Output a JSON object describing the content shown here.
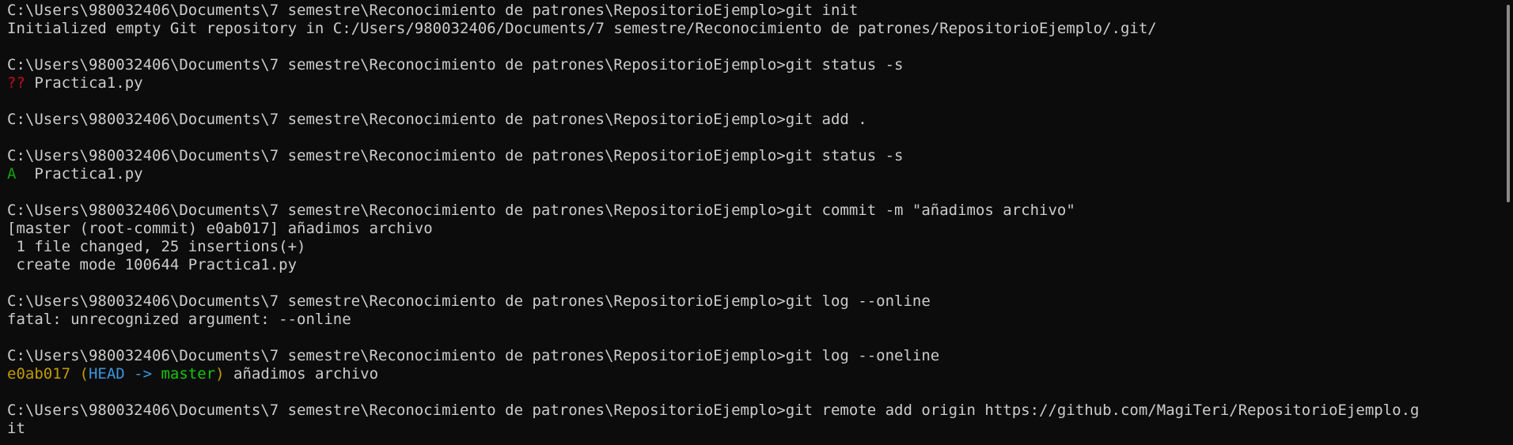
{
  "terminal": {
    "lines": [
      [
        {
          "text": "C:\\Users\\980032406\\Documents\\7 semestre\\Reconocimiento de patrones\\RepositorioEjemplo>git init",
          "color": "default"
        }
      ],
      [
        {
          "text": "Initialized empty Git repository in C:/Users/980032406/Documents/7 semestre/Reconocimiento de patrones/RepositorioEjemplo/.git/",
          "color": "default"
        }
      ],
      [],
      [
        {
          "text": "C:\\Users\\980032406\\Documents\\7 semestre\\Reconocimiento de patrones\\RepositorioEjemplo>git status -s",
          "color": "default"
        }
      ],
      [
        {
          "text": "??",
          "color": "red"
        },
        {
          "text": " Practica1.py",
          "color": "default"
        }
      ],
      [],
      [
        {
          "text": "C:\\Users\\980032406\\Documents\\7 semestre\\Reconocimiento de patrones\\RepositorioEjemplo>git add .",
          "color": "default"
        }
      ],
      [],
      [
        {
          "text": "C:\\Users\\980032406\\Documents\\7 semestre\\Reconocimiento de patrones\\RepositorioEjemplo>git status -s",
          "color": "default"
        }
      ],
      [
        {
          "text": "A",
          "color": "green"
        },
        {
          "text": "  Practica1.py",
          "color": "default"
        }
      ],
      [],
      [
        {
          "text": "C:\\Users\\980032406\\Documents\\7 semestre\\Reconocimiento de patrones\\RepositorioEjemplo>git commit -m \"añadimos archivo\"",
          "color": "default"
        }
      ],
      [
        {
          "text": "[master (root-commit) e0ab017] añadimos archivo",
          "color": "default"
        }
      ],
      [
        {
          "text": " 1 file changed, 25 insertions(+)",
          "color": "default"
        }
      ],
      [
        {
          "text": " create mode 100644 Practica1.py",
          "color": "default"
        }
      ],
      [],
      [
        {
          "text": "C:\\Users\\980032406\\Documents\\7 semestre\\Reconocimiento de patrones\\RepositorioEjemplo>git log --online",
          "color": "default"
        }
      ],
      [
        {
          "text": "fatal: unrecognized argument: --online",
          "color": "default"
        }
      ],
      [],
      [
        {
          "text": "C:\\Users\\980032406\\Documents\\7 semestre\\Reconocimiento de patrones\\RepositorioEjemplo>git log --oneline",
          "color": "default"
        }
      ],
      [
        {
          "text": "e0ab017",
          "color": "yellow"
        },
        {
          "text": " (",
          "color": "yellow"
        },
        {
          "text": "HEAD -> ",
          "color": "cyan"
        },
        {
          "text": "master",
          "color": "green-bright"
        },
        {
          "text": ")",
          "color": "yellow"
        },
        {
          "text": " añadimos archivo",
          "color": "default"
        }
      ],
      [],
      [
        {
          "text": "C:\\Users\\980032406\\Documents\\7 semestre\\Reconocimiento de patrones\\RepositorioEjemplo>git remote add origin https://github.com/MagiTeri/RepositorioEjemplo.g",
          "color": "default"
        }
      ],
      [
        {
          "text": "it",
          "color": "default"
        }
      ]
    ]
  },
  "colors": {
    "background": "#0c0c0c",
    "default": "#cccccc",
    "red": "#c50f1f",
    "green": "#13a10e",
    "yellow": "#c19c00",
    "cyan": "#3a96dd",
    "green-bright": "#16c60c"
  }
}
